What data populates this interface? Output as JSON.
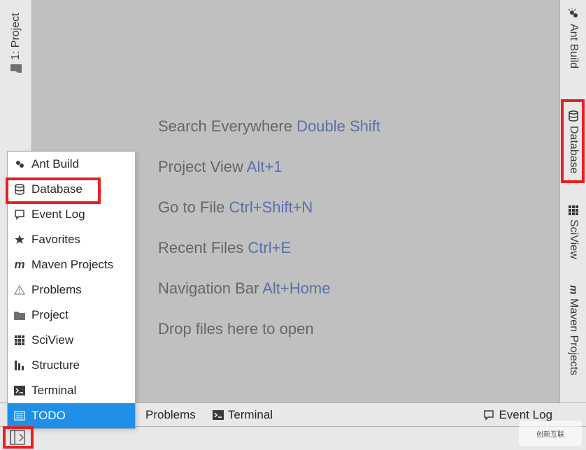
{
  "left_sidebar": {
    "project": {
      "label": "1: Project"
    }
  },
  "right_sidebar": {
    "ant": {
      "label": "Ant Build"
    },
    "database": {
      "label": "Database"
    },
    "sciview": {
      "label": "SciView"
    },
    "maven": {
      "label": "Maven Projects"
    }
  },
  "tips": {
    "search": {
      "text": "Search Everywhere",
      "shortcut": "Double Shift"
    },
    "project_view": {
      "text": "Project View",
      "shortcut": "Alt+1"
    },
    "goto_file": {
      "text": "Go to File",
      "shortcut": "Ctrl+Shift+N"
    },
    "recent_files": {
      "text": "Recent Files",
      "shortcut": "Ctrl+E"
    },
    "nav_bar": {
      "text": "Navigation Bar",
      "shortcut": "Alt+Home"
    },
    "drop": {
      "text": "Drop files here to open"
    }
  },
  "popup_menu": {
    "items": [
      {
        "label": "Ant Build"
      },
      {
        "label": "Database"
      },
      {
        "label": "Event Log"
      },
      {
        "label": "Favorites"
      },
      {
        "label": "Maven Projects"
      },
      {
        "label": "Problems"
      },
      {
        "label": "Project"
      },
      {
        "label": "SciView"
      },
      {
        "label": "Structure"
      },
      {
        "label": "Terminal"
      },
      {
        "label": "TODO"
      }
    ]
  },
  "bottom_bar": {
    "problems": "Problems",
    "terminal": "Terminal",
    "event_log": "Event Log"
  },
  "watermark": "创新互联"
}
